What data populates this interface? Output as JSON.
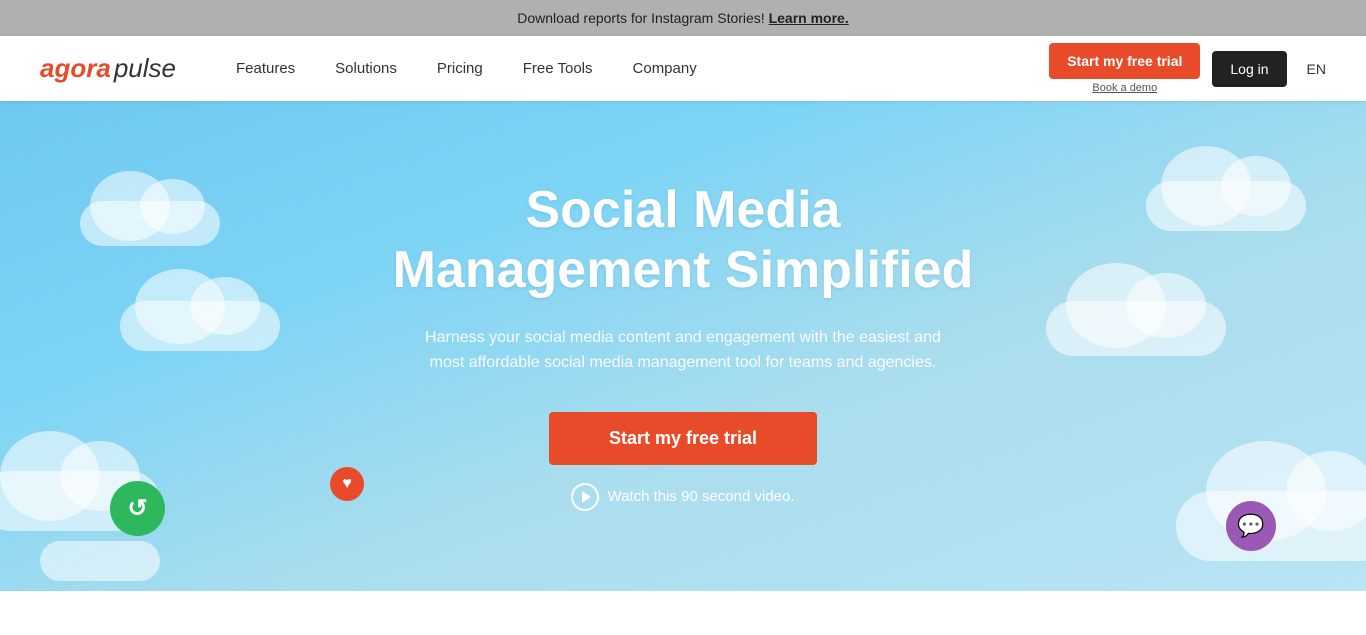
{
  "banner": {
    "text": "Download reports for Instagram Stories!",
    "link_text": "Learn more."
  },
  "navbar": {
    "logo_agora": "agora",
    "logo_pulse": "pulse",
    "nav_links": [
      {
        "label": "Features"
      },
      {
        "label": "Solutions"
      },
      {
        "label": "Pricing"
      },
      {
        "label": "Free Tools"
      },
      {
        "label": "Company"
      }
    ],
    "trial_button": "Start my free trial",
    "book_demo": "Book a demo",
    "login_button": "Log in",
    "lang": "EN"
  },
  "hero": {
    "title_line1": "Social Media",
    "title_line2": "Management Simplified",
    "subtitle": "Harness your social media content and engagement with the easiest and most affordable social media management tool for teams and agencies.",
    "cta_button": "Start my free trial",
    "watch_video": "Watch this 90 second video."
  },
  "icons": {
    "play": "▶",
    "refresh": "↻",
    "heart": "♥",
    "chat": "💬"
  }
}
